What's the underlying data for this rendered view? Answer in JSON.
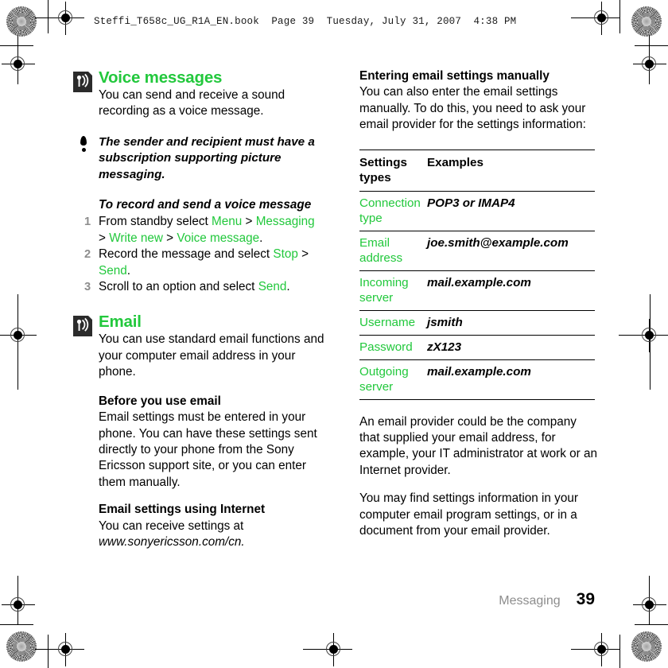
{
  "header": {
    "line": "Steffi_T658c_UG_R1A_EN.book  Page 39  Tuesday, July 31, 2007  4:38 PM"
  },
  "colors": {
    "accent_green": "#22c83c",
    "footer_gray": "#8d8d8d",
    "text_black": "#000000"
  },
  "left_column": {
    "voice_section": {
      "icon": "signal-waves-icon",
      "title": "Voice messages",
      "intro": "You can send and receive a sound recording as a voice message."
    },
    "note": {
      "icon": "exclamation-icon",
      "text": "The sender and recipient must have a subscription supporting picture messaging."
    },
    "procedure": {
      "title": "To record and send a voice message",
      "steps": [
        {
          "num": "1",
          "parts": [
            {
              "t": "From standby select ",
              "green": false
            },
            {
              "t": "Menu",
              "green": true
            },
            {
              "t": " > ",
              "green": false
            },
            {
              "t": "Messaging",
              "green": true
            },
            {
              "t": " > ",
              "green": false
            },
            {
              "t": "Write new",
              "green": true
            },
            {
              "t": " > ",
              "green": false
            },
            {
              "t": "Voice message",
              "green": true
            },
            {
              "t": ".",
              "green": false
            }
          ]
        },
        {
          "num": "2",
          "parts": [
            {
              "t": "Record the message and select ",
              "green": false
            },
            {
              "t": "Stop",
              "green": true
            },
            {
              "t": " > ",
              "green": false
            },
            {
              "t": "Send",
              "green": true
            },
            {
              "t": ".",
              "green": false
            }
          ]
        },
        {
          "num": "3",
          "parts": [
            {
              "t": "Scroll to an option and select ",
              "green": false
            },
            {
              "t": "Send",
              "green": true
            },
            {
              "t": ".",
              "green": false
            }
          ]
        }
      ]
    },
    "email_section": {
      "icon": "signal-waves-icon",
      "title": "Email",
      "intro": "You can use standard email functions and your computer email address in your phone."
    },
    "before_you_use": {
      "heading": "Before you use email",
      "body": "Email settings must be entered in your phone. You can have these settings sent directly to your phone from the Sony Ericsson support site, or you can enter them manually."
    },
    "settings_internet": {
      "heading": "Email settings using Internet",
      "body_plain": "You can receive settings at ",
      "body_italic": "www.sonyericsson.com/cn."
    }
  },
  "right_column": {
    "manual_section": {
      "heading": "Entering email settings manually",
      "body": "You can also enter the email settings manually. To do this, you need to ask your email provider for the settings information:"
    },
    "table": {
      "headers": [
        "Settings types",
        "Examples"
      ],
      "rows": [
        {
          "key": "Connection type",
          "value": "POP3 or IMAP4"
        },
        {
          "key": "Email address",
          "value": "joe.smith@example.com"
        },
        {
          "key": "Incoming server",
          "value": "mail.example.com"
        },
        {
          "key": "Username",
          "value": "jsmith"
        },
        {
          "key": "Password",
          "value": "zX123"
        },
        {
          "key": "Outgoing server",
          "value": "mail.example.com"
        }
      ]
    },
    "after_table": {
      "para1": "An email provider could be the company that supplied your email address, for example, your IT administrator at work or an Internet provider.",
      "para2": "You may find settings information in your computer email program settings, or in a document from your email provider."
    }
  },
  "footer": {
    "chapter": "Messaging",
    "page_number": "39"
  }
}
